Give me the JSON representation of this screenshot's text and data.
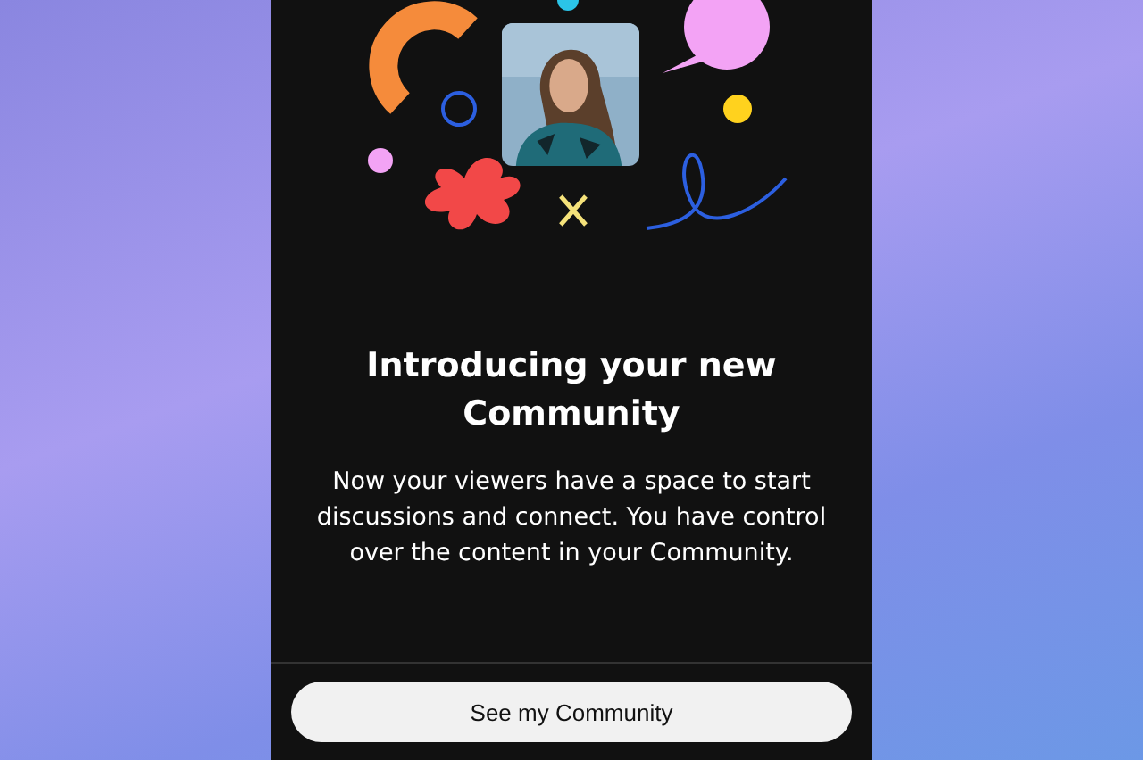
{
  "title": "Introducing your new Community",
  "description": "Now your viewers have a space to start discussions and connect. You have control over the content in your Community.",
  "button": {
    "label": "See my Community"
  }
}
